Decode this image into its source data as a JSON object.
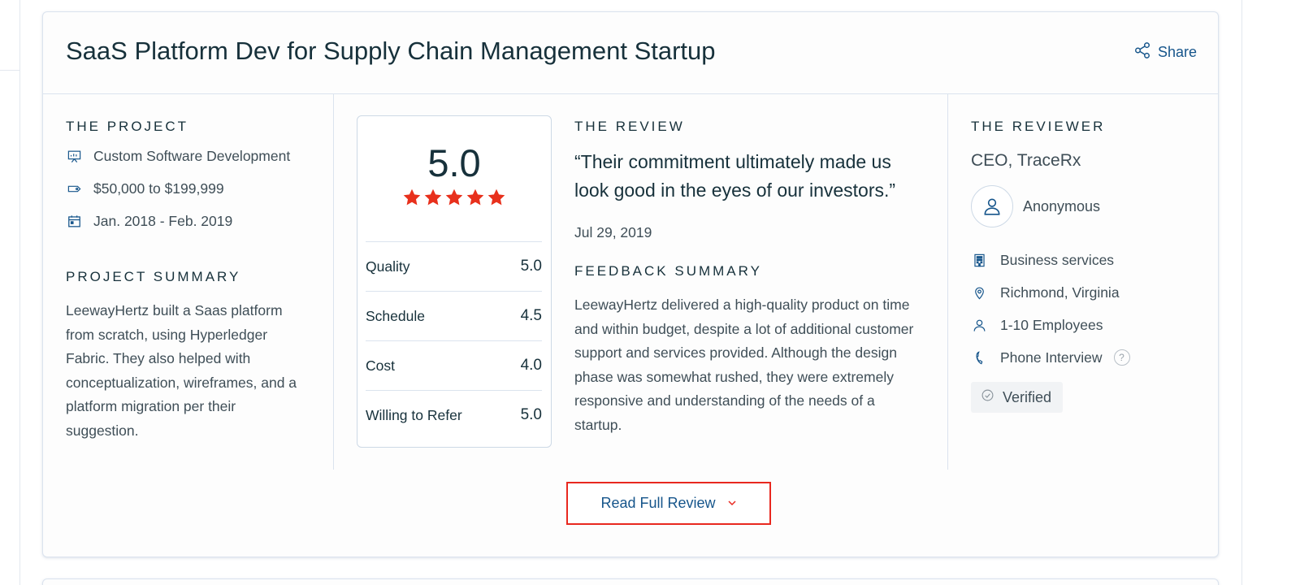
{
  "card": {
    "title": "SaaS Platform Dev for Supply Chain Management Startup",
    "share_label": "Share"
  },
  "project": {
    "section_label": "THE PROJECT",
    "service": "Custom Software Development",
    "budget": "$50,000 to $199,999",
    "dates": "Jan. 2018 - Feb. 2019",
    "summary_label": "PROJECT SUMMARY",
    "summary_text": "LeewayHertz built a Saas platform from scratch, using Hyperledger Fabric. They also helped with conceptualization, wireframes, and a platform migration per their suggestion."
  },
  "scores": {
    "overall": "5.0",
    "star_rating": 5,
    "star_color": "#e8301c",
    "rows": [
      {
        "label": "Quality",
        "value": "5.0"
      },
      {
        "label": "Schedule",
        "value": "4.5"
      },
      {
        "label": "Cost",
        "value": "4.0"
      },
      {
        "label": "Willing to Refer",
        "value": "5.0"
      }
    ]
  },
  "review": {
    "section_label": "THE REVIEW",
    "quote": "“Their commitment ultimately made us look good in the eyes of our investors.”",
    "date": "Jul 29, 2019",
    "feedback_label": "FEEDBACK SUMMARY",
    "feedback_text": "LeewayHertz delivered a high-quality product on time and within budget, despite a lot of additional customer support and services provided. Although the design phase was somewhat rushed, they were extremely responsive and understanding of the needs of a startup."
  },
  "reviewer": {
    "section_label": "THE REVIEWER",
    "title": "CEO, TraceRx",
    "name": "Anonymous",
    "industry": "Business services",
    "location": "Richmond, Virginia",
    "company_size": "1-10 Employees",
    "review_type": "Phone Interview",
    "help_glyph": "?",
    "verified_label": "Verified"
  },
  "actions": {
    "read_full_review": "Read Full Review"
  },
  "colors": {
    "accent_link": "#16558b",
    "highlight_border": "#e8281f",
    "text_dark": "#17313b",
    "text_body": "#3f4e57"
  }
}
